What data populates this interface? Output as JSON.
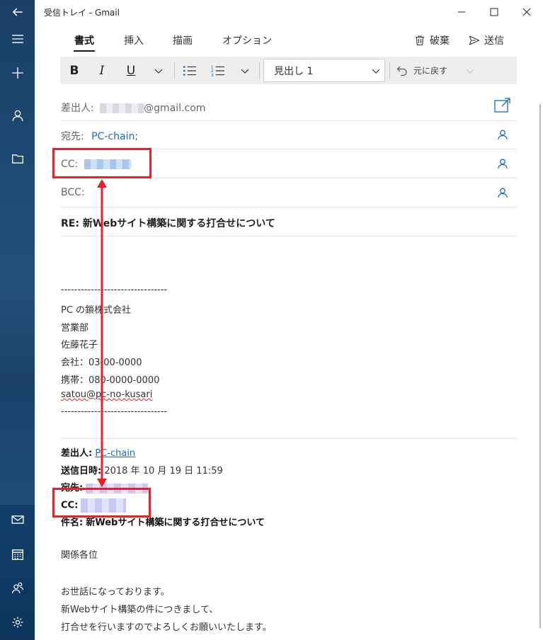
{
  "window": {
    "title": "受信トレイ - Gmail"
  },
  "rail": {
    "icons": [
      "back-arrow-icon",
      "hamburger-menu-icon",
      "new-mail-plus-icon",
      "account-icon",
      "folder-icon",
      "mail-icon",
      "calendar-icon",
      "people-icon",
      "settings-gear-icon"
    ]
  },
  "ribbon": {
    "tabs": [
      "書式",
      "挿入",
      "描画",
      "オプション"
    ],
    "active_tab": "書式",
    "discard_label": "破棄",
    "send_label": "送信"
  },
  "toolbar": {
    "bold": "B",
    "italic": "I",
    "underline": "U",
    "heading_value": "見出し 1",
    "undo_label": "元に戻す"
  },
  "compose": {
    "from_label": "差出人:",
    "from_domain": "@gmail.com",
    "to_label": "宛先:",
    "to_value": "PC-chain;",
    "cc_label": "CC:",
    "bcc_label": "BCC:",
    "subject": "RE: 新Webサイト構築に関する打合せについて"
  },
  "signature": {
    "rule": "--------------------------------",
    "lines": [
      "PC の鎖株式会社",
      "営業部",
      "佐藤花子",
      "会社：03-00-0000",
      "携帯：080-0000-0000"
    ],
    "email": "satou@pc-no-kusari",
    "rule_end": "--------------------------------"
  },
  "quoted": {
    "from_label": "差出人:",
    "from_value": "PC-chain",
    "sent_label": "送信日時:",
    "sent_value": "2018 年 10 月 19 日 11:59",
    "to_label": "宛先:",
    "cc_label": "CC:",
    "subject_label": "件名:",
    "subject_value": "新Webサイト構築に関する打合せについて",
    "greeting": "関係各位",
    "body": [
      "お世話になっております。",
      "新Webサイト構築の件につきまして、",
      "打合せを行いますのでよろしくお願いいたします。"
    ]
  },
  "colors": {
    "accent": "#1a6bb8",
    "annotation_red": "#e8202a",
    "rail": "#1e4a74"
  }
}
